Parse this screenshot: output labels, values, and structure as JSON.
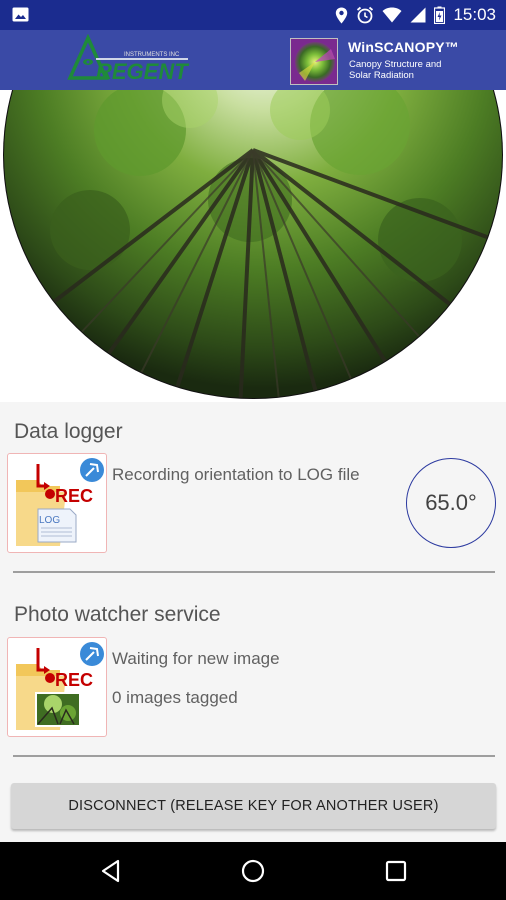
{
  "status_bar": {
    "time": "15:03",
    "icons": [
      "image-icon",
      "location-icon",
      "alarm-icon",
      "wifi-icon",
      "signal-icon",
      "battery-icon"
    ]
  },
  "header": {
    "brand_logo": "REGENT",
    "brand_logo_small": "INSTRUMENTS INC",
    "app_title": "WinSCANOPY™",
    "app_subtitle_line1": "Canopy Structure and",
    "app_subtitle_line2": "Solar Radiation"
  },
  "data_logger": {
    "title": "Data logger",
    "status": "Recording orientation to LOG file",
    "orientation_value": "65.0°",
    "icon_label": "REC",
    "icon_file_label": "LOG"
  },
  "photo_watcher": {
    "title": "Photo watcher service",
    "status": "Waiting for new image",
    "count_text": "0 images tagged",
    "icon_label": "REC"
  },
  "actions": {
    "disconnect_label": "DISCONNECT (RELEASE KEY FOR ANOTHER USER)"
  },
  "nav": [
    "back-icon",
    "home-icon",
    "recents-icon"
  ],
  "colors": {
    "status_bar": "#1b2c8f",
    "header": "#3a4aa6",
    "gauge_border": "#2c3aa0",
    "rec_red": "#c40000"
  }
}
